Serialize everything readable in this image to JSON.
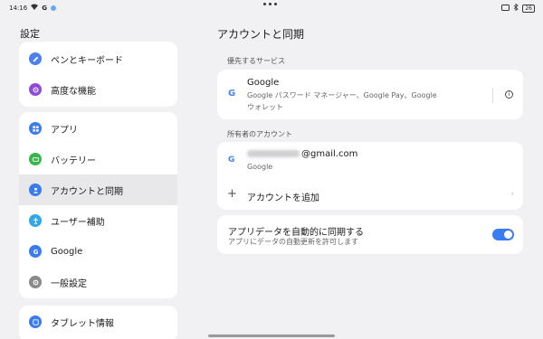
{
  "status_bar": {
    "time": "14:16",
    "battery": "26"
  },
  "left": {
    "title": "設定",
    "group1": [
      {
        "label": "ペンとキーボード",
        "icon": "pen-icon",
        "color": "#4c7ff2"
      },
      {
        "label": "高度な機能",
        "icon": "advanced-icon",
        "color": "#8f4bd8"
      }
    ],
    "group2": [
      {
        "label": "アプリ",
        "icon": "apps-icon",
        "color": "#3a7bf0"
      },
      {
        "label": "バッテリー",
        "icon": "battery-icon",
        "color": "#39b54a"
      },
      {
        "label": "アカウントと同期",
        "icon": "account-icon",
        "color": "#3a7bf0"
      },
      {
        "label": "ユーザー補助",
        "icon": "accessibility-icon",
        "color": "#2fa7e8"
      },
      {
        "label": "Google",
        "icon": "google-icon",
        "color": "#3a7bf0"
      },
      {
        "label": "一般設定",
        "icon": "general-settings-icon",
        "color": "#8a8a8a"
      }
    ],
    "group3": [
      {
        "label": "タブレット情報",
        "icon": "tablet-info-icon",
        "color": "#3a7bf0"
      }
    ],
    "active_item": "アカウントと同期"
  },
  "right": {
    "title": "アカウントと同期",
    "preferred_label": "優先するサービス",
    "preferred": {
      "title": "Google",
      "sub1": "Google パスワード マネージャー、Google Pay、Google",
      "sub2": "ウォレット"
    },
    "owner_label": "所有者のアカウント",
    "account": {
      "email_suffix": "@gmail.com",
      "provider": "Google"
    },
    "add_account": "アカウントを追加",
    "autosync": {
      "title": "アプリデータを自動的に同期する",
      "sub": "アプリにデータの自動更新を許可します",
      "enabled": true
    }
  }
}
